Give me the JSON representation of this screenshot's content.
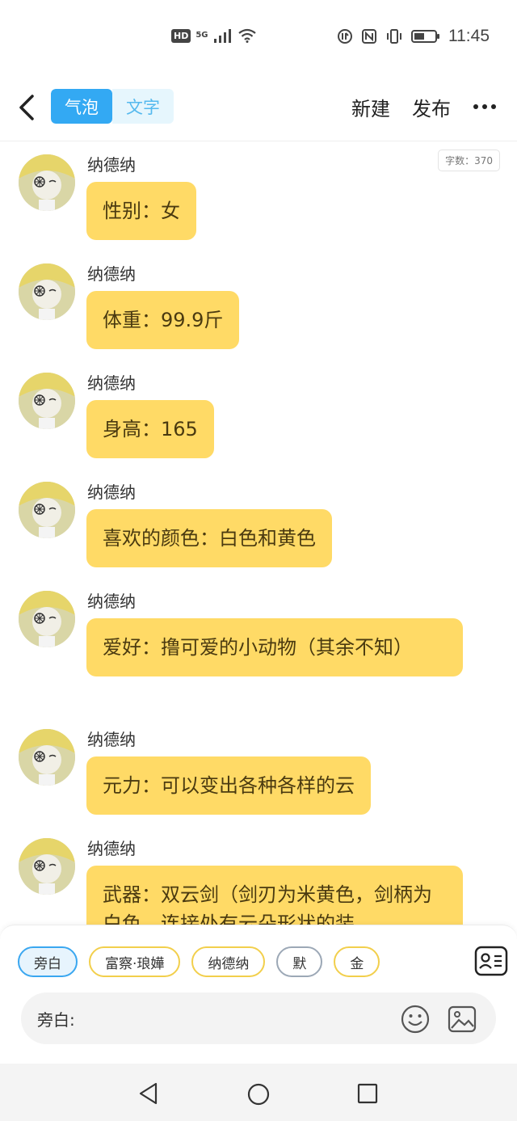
{
  "status_bar": {
    "hd": "HD",
    "network": "5G",
    "time": "11:45"
  },
  "header": {
    "tabs": [
      {
        "label": "气泡",
        "active": true
      },
      {
        "label": "文字",
        "active": false
      }
    ],
    "new_label": "新建",
    "publish_label": "发布"
  },
  "word_count": "字数：370",
  "messages": [
    {
      "name": "纳德纳",
      "text": "性别：女"
    },
    {
      "name": "纳德纳",
      "text": "体重：99.9斤"
    },
    {
      "name": "纳德纳",
      "text": "身高：165"
    },
    {
      "name": "纳德纳",
      "text": "喜欢的颜色：白色和黄色"
    },
    {
      "name": "纳德纳",
      "text": "爱好：撸可爱的小动物（其余不知）"
    },
    {
      "name": "纳德纳",
      "text": "元力：可以变出各种各样的云"
    },
    {
      "name": "纳德纳",
      "text": "武器：双云剑（剑刃为米黄色，剑柄为白色，连接处有云朵形状的装"
    }
  ],
  "composer": {
    "roles": [
      "旁白",
      "富察·琅嬅",
      "纳德纳",
      "默",
      "金"
    ],
    "selected_role": "旁白",
    "input_label": "旁白:",
    "input_value": ""
  },
  "colors": {
    "accent": "#33a9f3",
    "bubble": "#ffda66",
    "role_border": "#f2cf4c"
  }
}
